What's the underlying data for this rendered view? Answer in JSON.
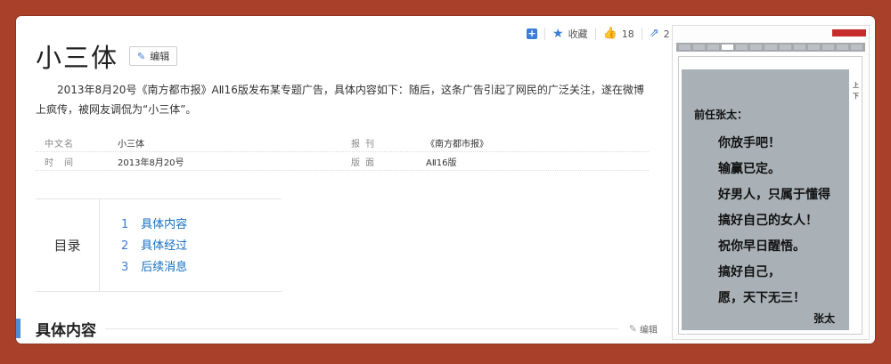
{
  "toolbar": {
    "favorite_label": "收藏",
    "like_count": "18",
    "share_count": "2"
  },
  "header": {
    "title": "小三体",
    "edit_label": "编辑"
  },
  "summary": "2013年8月20号《南方都市报》AⅡ16版发布某专题广告，具体内容如下：随后，这条广告引起了网民的广泛关注，遂在微博上疯传，被网友调侃为“小三体”。",
  "info": {
    "rows": [
      {
        "k1": "中文名",
        "v1": "小三体",
        "k2": "报刊",
        "v2": "《南方都市报》"
      },
      {
        "k1": "时　间",
        "v1": "2013年8月20号",
        "k2": "版面",
        "v2": "AⅡ16版"
      }
    ]
  },
  "catalog": {
    "title": "目录",
    "items": [
      {
        "num": "1",
        "label": "具体内容"
      },
      {
        "num": "2",
        "label": "具体经过"
      },
      {
        "num": "3",
        "label": "后续消息"
      }
    ]
  },
  "section": {
    "title": "具体内容",
    "edit_label": "编辑"
  },
  "ad": {
    "salute": "前任张太：",
    "lines": [
      "你放手吧！",
      "输赢已定。",
      "好男人，只属于懂得",
      "搞好自己的女人！",
      "祝你早日醒悟。",
      "搞好自己，",
      "愿，天下无三！"
    ],
    "signature": "张太",
    "side_text": "上 下"
  },
  "colors": {
    "accent": "#3b7dd8",
    "frame": "#a8402a",
    "link": "#136ec2"
  }
}
